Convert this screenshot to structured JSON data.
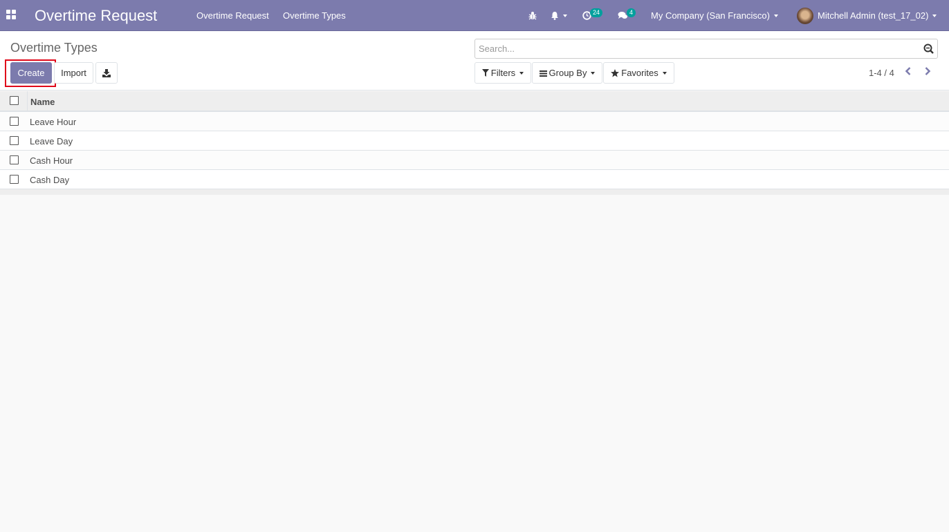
{
  "navbar": {
    "app_title": "Overtime Request",
    "menus": [
      "Overtime Request",
      "Overtime Types"
    ],
    "activity_count": "24",
    "message_count": "4",
    "company": "My Company (San Francisco)",
    "user": "Mitchell Admin (test_17_02)",
    "icons": [
      "apps-grid-icon",
      "bug-icon",
      "bell-icon",
      "clock-icon",
      "chat-icon"
    ]
  },
  "control": {
    "title": "Overtime Types",
    "create_label": "Create",
    "import_label": "Import",
    "search_placeholder": "Search...",
    "filters_label": "Filters",
    "groupby_label": "Group By",
    "favorites_label": "Favorites",
    "pager": "1-4 / 4"
  },
  "list": {
    "columns": [
      "Name"
    ],
    "rows": [
      {
        "name": "Leave Hour"
      },
      {
        "name": "Leave Day"
      },
      {
        "name": "Cash Hour"
      },
      {
        "name": "Cash Day"
      }
    ]
  },
  "colors": {
    "brand": "#7c7bad",
    "badge": "#00a09d",
    "highlight": "#e0081a"
  }
}
